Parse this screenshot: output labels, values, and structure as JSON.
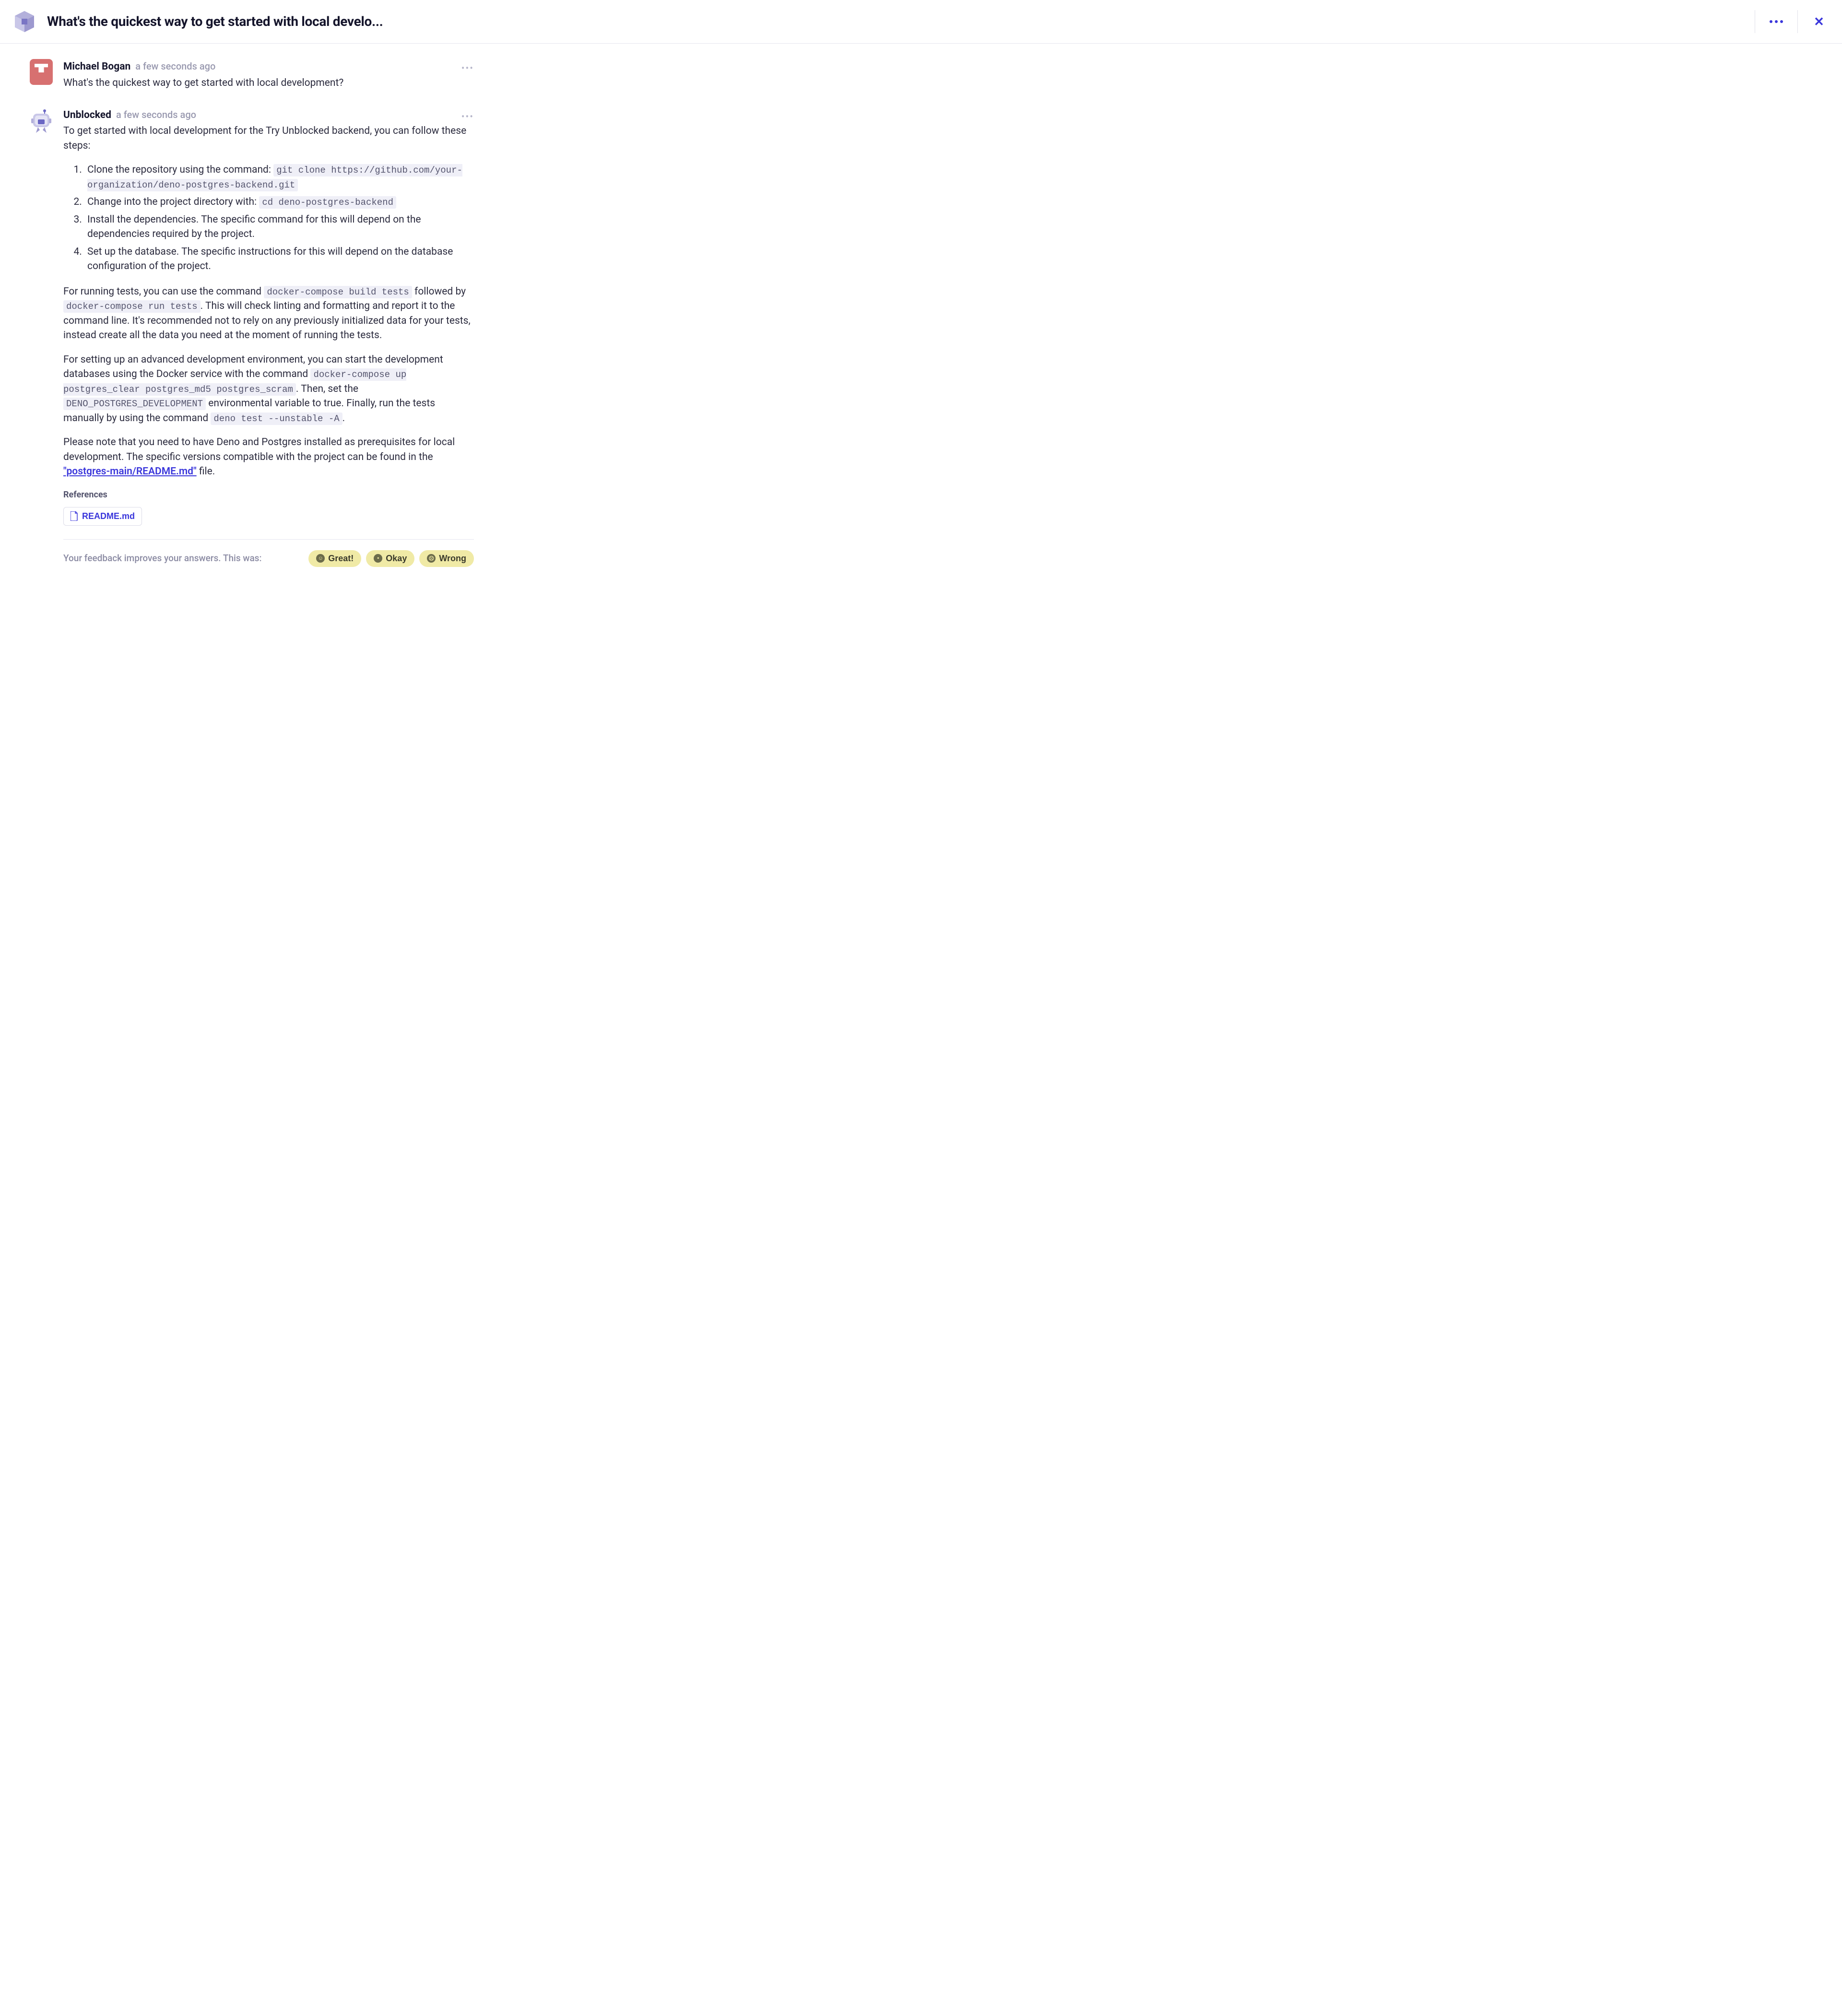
{
  "header": {
    "title": "What's the quickest way to get started with local develo..."
  },
  "messages": {
    "user": {
      "author": "Michael Bogan",
      "timestamp": "a few seconds ago",
      "text": "What's the quickest way to get started with local development?"
    },
    "bot": {
      "author": "Unblocked",
      "timestamp": "a few seconds ago",
      "intro": "To get started with local development for the Try Unblocked backend, you can follow these steps:",
      "steps": {
        "s1_pre": "Clone the repository using the command: ",
        "s1_code": "git clone https://github.com/your-organization/deno-postgres-backend.git",
        "s2_pre": "Change into the project directory with: ",
        "s2_code": "cd deno-postgres-backend",
        "s3": "Install the dependencies. The specific command for this will depend on the dependencies required by the project.",
        "s4": "Set up the database. The specific instructions for this will depend on the database configuration of the project."
      },
      "p2": {
        "a": "For running tests, you can use the command ",
        "c1": "docker-compose build tests",
        "b": " followed by ",
        "c2": "docker-compose run tests",
        "c": ". This will check linting and formatting and report it to the command line. It's recommended not to rely on any previously initialized data for your tests, instead create all the data you need at the moment of running the tests."
      },
      "p3": {
        "a": "For setting up an advanced development environment, you can start the development databases using the Docker service with the command ",
        "c1": "docker-compose up postgres_clear postgres_md5 postgres_scram",
        "b": ". Then, set the ",
        "c2": "DENO_POSTGRES_DEVELOPMENT",
        "c": " environmental variable to true. Finally, run the tests manually by using the command ",
        "c3": "deno test --unstable -A",
        "d": "."
      },
      "p4": {
        "a": "Please note that you need to have Deno and Postgres installed as prerequisites for local development. The specific versions compatible with the project can be found in the ",
        "link": "\"postgres-main/README.md\"",
        "b": " file."
      },
      "references_label": "References",
      "references": [
        {
          "label": "README.md"
        }
      ]
    }
  },
  "feedback": {
    "prompt": "Your feedback improves your answers. This was:",
    "great": "Great!",
    "okay": "Okay",
    "wrong": "Wrong"
  }
}
